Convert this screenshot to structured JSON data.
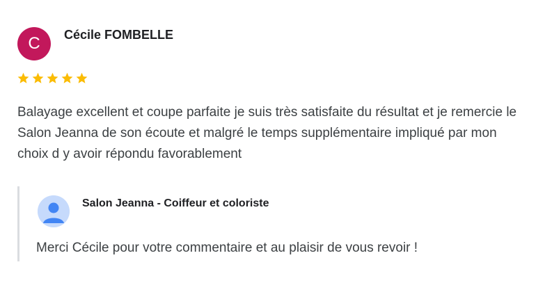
{
  "review": {
    "avatar_letter": "C",
    "avatar_color": "#c2185b",
    "author": "Cécile FOMBELLE",
    "rating": 5,
    "rating_max": 5,
    "star_color": "#fbbc04",
    "text": "Balayage excellent et coupe parfaite je suis très satisfaite du résultat et je remercie le Salon Jeanna de son écoute et malgré le temps supplémentaire impliqué par mon choix d y avoir répondu favorablement"
  },
  "reply": {
    "avatar_icon": "default-user-avatar-icon",
    "author": "Salon Jeanna - Coiffeur et coloriste",
    "text": "Merci Cécile pour votre commentaire et au plaisir de vous revoir !"
  }
}
